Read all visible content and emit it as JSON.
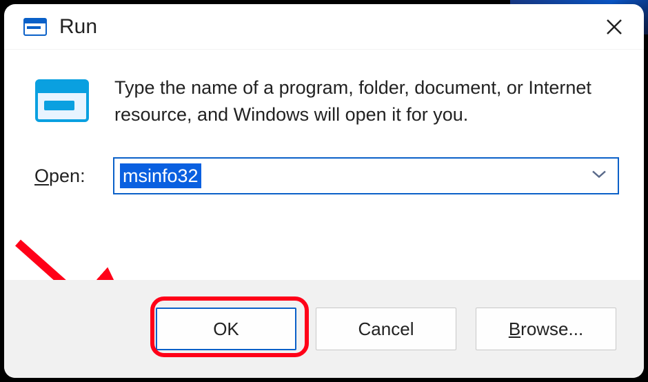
{
  "title": "Run",
  "description": "Type the name of a program, folder, document, or Internet resource, and Windows will open it for you.",
  "open_label_prefix": "O",
  "open_label_rest": "pen:",
  "input_value": "msinfo32",
  "buttons": {
    "ok": "OK",
    "cancel": "Cancel",
    "browse_prefix": "B",
    "browse_rest": "rowse..."
  }
}
